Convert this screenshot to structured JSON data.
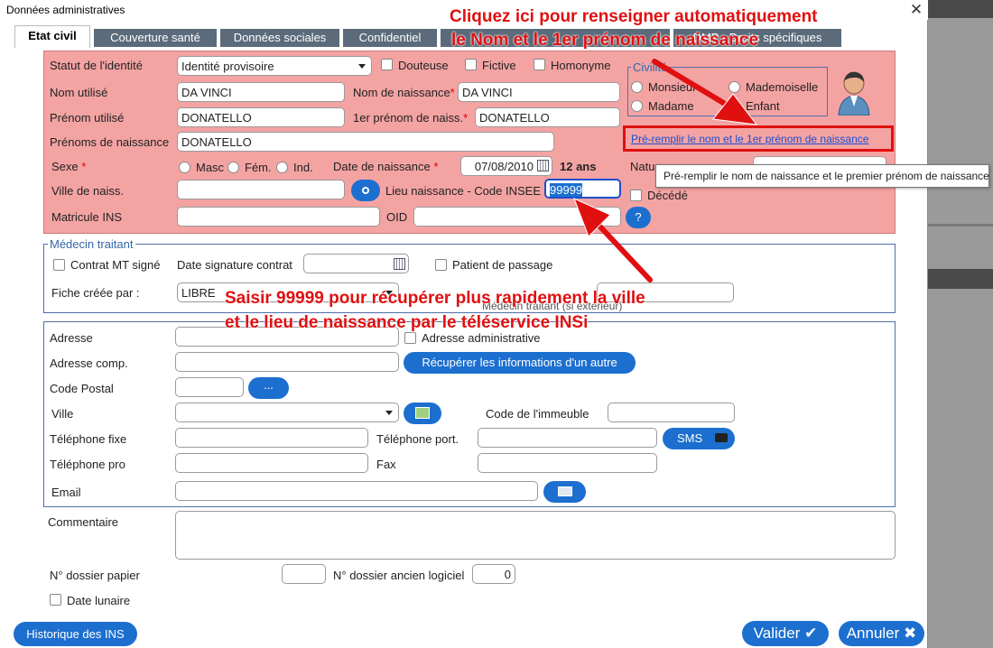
{
  "window": {
    "title": "Données administratives"
  },
  "tabs": [
    {
      "label": "Etat civil"
    },
    {
      "label": "Couverture santé"
    },
    {
      "label": "Données sociales"
    },
    {
      "label": "Confidentiel"
    },
    {
      "label": ""
    },
    {
      "label": "DMP - Droits spécifiques"
    }
  ],
  "identity": {
    "statut_label": "Statut de l'identité",
    "statut_value": "Identité provisoire",
    "douteuse": "Douteuse",
    "fictive": "Fictive",
    "homonyme": "Homonyme",
    "nom_utilise_label": "Nom utilisé",
    "nom_utilise_value": "DA VINCI",
    "nom_naissance_label": "Nom de naissance",
    "nom_naissance_value": "DA VINCI",
    "prenom_utilise_label": "Prénom utilisé",
    "prenom_utilise_value": "DONATELLO",
    "premier_prenom_label": "1er prénom de naiss.",
    "premier_prenom_value": "DONATELLO",
    "prenoms_naissance_label": "Prénoms de naissance",
    "prenoms_naissance_value": "DONATELLO",
    "sexe_label": "Sexe",
    "masc": "Masc",
    "fem": "Fém.",
    "ind": "Ind.",
    "date_naissance_label": "Date de naissance",
    "date_naissance_value": "07/08/2010",
    "age": "12 ans",
    "ville_label": "Ville de naiss.",
    "lieu_label": "Lieu naissance - Code INSEE",
    "lieu_value": "99999",
    "matricule_label": "Matricule INS",
    "oid_label": "OID",
    "nature_label": "Natu",
    "decede": "Décédé",
    "help": "?",
    "civilite_legend": "Civilité",
    "monsieur": "Monsieur",
    "mademoiselle": "Mademoiselle",
    "madame": "Madame",
    "enfant": "Enfant",
    "prefill_link": "Pré-remplir le nom et le 1er prénom de naissance",
    "tooltip": "Pré-remplir le nom de naissance et le premier prénom de naissance"
  },
  "medecin": {
    "legend": "Médecin traitant",
    "contrat": "Contrat MT signé",
    "date_sig": "Date signature contrat",
    "passage": "Patient de passage",
    "fiche_label": "Fiche créée par :",
    "fiche_value": "LIBRE",
    "mt_label": "Médecin traitant (si extérieur)"
  },
  "address": {
    "adresse": "Adresse",
    "adresse_admin": "Adresse administrative",
    "adresse_comp": "Adresse comp.",
    "recup": "Récupérer les informations d'un autre",
    "code_postal": "Code Postal",
    "dots": "...",
    "ville": "Ville",
    "immeuble": "Code de l'immeuble",
    "tel_fixe": "Téléphone fixe",
    "tel_port": "Téléphone port.",
    "sms": "SMS",
    "tel_pro": "Téléphone pro",
    "fax": "Fax",
    "email": "Email"
  },
  "misc": {
    "commentaire": "Commentaire",
    "dossier_papier": "N° dossier papier",
    "dossier_ancien": "N° dossier ancien logiciel",
    "dossier_ancien_value": "0",
    "date_lunaire": "Date lunaire"
  },
  "footer": {
    "historique": "Historique des INS",
    "valider": "Valider",
    "annuler": "Annuler"
  },
  "annotations": {
    "top_line1": "Cliquez ici pour renseigner automatiquement",
    "top_line2": "le Nom et le 1er prénom de naissance",
    "bottom_line1": "Saisir 99999 pour récupérer  plus rapidement la ville",
    "bottom_line2": "et le lieu de naissance par le téléservice INSi"
  },
  "colors": {
    "annotation": "#e01010",
    "accent": "#1c6fcf",
    "id_bg": "#f4a3a3"
  }
}
